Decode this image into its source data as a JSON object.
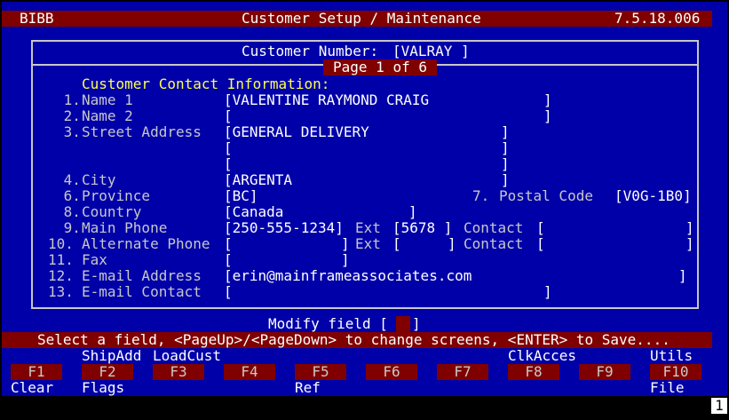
{
  "header": {
    "app": "BIBB",
    "title": "Customer Setup / Maintenance",
    "version": "7.5.18.006"
  },
  "form": {
    "customer_number_label": "Customer Number:",
    "customer_number_value": "[VALRAY ]",
    "page_indicator": "Page 1 of 6",
    "section_heading": "Customer Contact Information:",
    "fields": {
      "name1": {
        "number": " 1.",
        "label": "Name 1",
        "value": "[VALENTINE RAYMOND CRAIG",
        "close": "]"
      },
      "name2": {
        "number": " 2.",
        "label": "Name 2",
        "value": "[",
        "close": "]"
      },
      "street": {
        "number": " 3.",
        "label": "Street Address",
        "line1": "[GENERAL DELIVERY",
        "line2": "[",
        "line3": "[",
        "close": "]"
      },
      "city": {
        "number": " 4.",
        "label": "City",
        "value": "[ARGENTA",
        "close": "]"
      },
      "province": {
        "number": " 6.",
        "label": "Province",
        "value": "[BC]"
      },
      "postal": {
        "number": "7.",
        "label": "Postal Code",
        "value": "[V0G-1B0]"
      },
      "country": {
        "number": " 8.",
        "label": "Country",
        "value": "[Canada",
        "close": "]"
      },
      "main_phone": {
        "number": " 9.",
        "label": "Main Phone",
        "value": "[250-555-1234]",
        "ext_label": "Ext",
        "ext_value": "[5678 ]",
        "contact_label": "Contact",
        "contact_value": "[",
        "close": "]"
      },
      "alt_phone": {
        "number": "10.",
        "label": "Alternate Phone",
        "value": "[",
        "value_close": "]",
        "ext_label": "Ext",
        "ext_value": "[",
        "ext_close": "]",
        "contact_label": "Contact",
        "contact_value": "[",
        "close": "]"
      },
      "fax": {
        "number": "11.",
        "label": "Fax",
        "value": "[",
        "close": "]"
      },
      "email": {
        "number": "12.",
        "label": "E-mail Address",
        "value": "[erin@mainframeassociates.com",
        "close": "]"
      },
      "email_contact": {
        "number": "13.",
        "label": "E-mail Contact",
        "value": "[",
        "close": "]"
      }
    }
  },
  "prompt": {
    "label": "Modify field [",
    "close": "]"
  },
  "status": {
    "message": "Select a field, <PageUp>/<PageDown> to change screens, <ENTER> to Save...."
  },
  "function_keys": {
    "hints": [
      "",
      "ShipAdd",
      "LoadCust",
      "",
      "",
      "",
      "",
      "ClkAcces",
      "",
      "Utils"
    ],
    "keys": [
      "F1",
      "F2",
      "F3",
      "F4",
      "F5",
      "F6",
      "F7",
      "F8",
      "F9",
      "F10"
    ],
    "subs": [
      "Clear",
      "Flags",
      "",
      "",
      "Ref",
      "",
      "",
      "",
      "",
      "File"
    ]
  },
  "footer": {
    "page_number": "1"
  }
}
